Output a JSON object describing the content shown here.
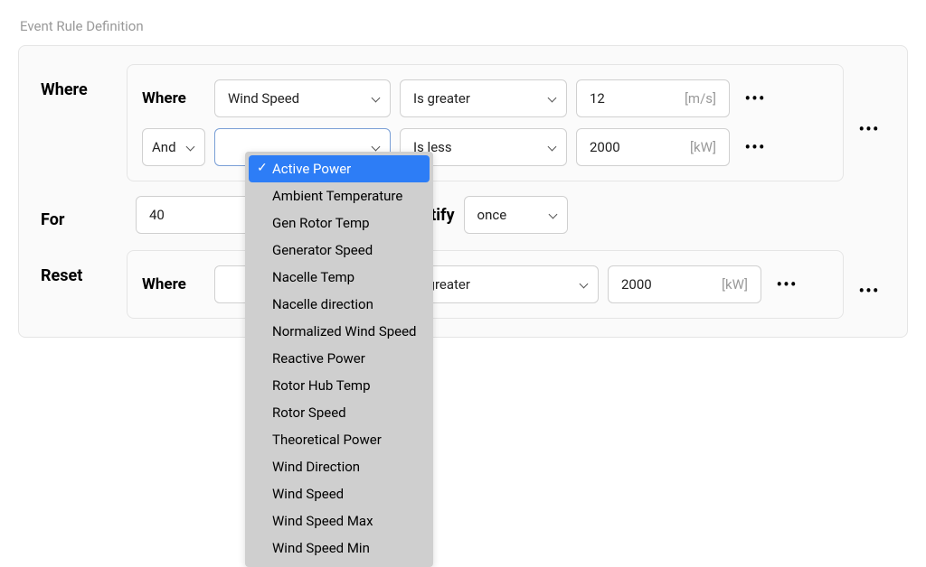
{
  "title": "Event Rule Definition",
  "labels": {
    "where": "Where",
    "for": "For",
    "reset": "Reset",
    "notify": "otify",
    "subwhere": "Where"
  },
  "where_section": {
    "rows": [
      {
        "conjunction": null,
        "variable": "Wind Speed",
        "operator": "Is greater",
        "value": "12",
        "unit": "[m/s]"
      },
      {
        "conjunction": "And",
        "variable": "",
        "operator": "Is less",
        "value": "2000",
        "unit": "[kW]"
      }
    ]
  },
  "for_section": {
    "value": "40",
    "notify_value": "once"
  },
  "reset_section": {
    "rows": [
      {
        "conjunction": null,
        "variable": "",
        "operator": "Is greater",
        "value": "2000",
        "unit": "[kW]"
      }
    ]
  },
  "dropdown": {
    "selected_index": 0,
    "items": [
      "Active Power",
      "Ambient Temperature",
      "Gen Rotor Temp",
      "Generator Speed",
      "Nacelle Temp",
      "Nacelle direction",
      "Normalized Wind Speed",
      "Reactive Power",
      "Rotor Hub Temp",
      "Rotor Speed",
      "Theoretical Power",
      "Wind Direction",
      "Wind Speed",
      "Wind Speed Max",
      "Wind Speed Min"
    ]
  },
  "dots": "•••"
}
